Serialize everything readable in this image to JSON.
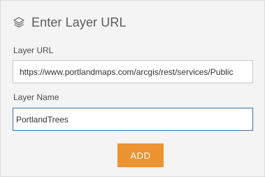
{
  "dialog": {
    "title": "Enter Layer URL",
    "icon": "layers-icon"
  },
  "layer_url": {
    "label": "Layer URL",
    "value": "https://www.portlandmaps.com/arcgis/rest/services/Public"
  },
  "layer_name": {
    "label": "Layer Name",
    "value": "PortlandTrees"
  },
  "actions": {
    "add_label": "ADD"
  },
  "colors": {
    "accent": "#ed9331",
    "focus_border": "#3e6fa6",
    "panel_background": "#f4f4f4"
  }
}
